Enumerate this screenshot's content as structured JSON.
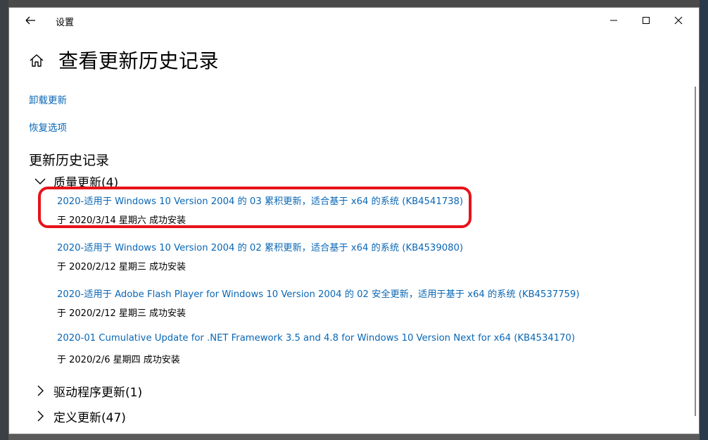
{
  "window": {
    "title": "设置"
  },
  "page": {
    "title": "查看更新历史记录"
  },
  "links": {
    "uninstall": "卸载更新",
    "recovery": "恢复选项"
  },
  "history": {
    "section_title": "更新历史记录",
    "groups": [
      {
        "label": "质量更新(4)",
        "expanded": true,
        "items": [
          {
            "title": "2020-适用于 Windows 10 Version 2004 的 03 累积更新，适合基于 x64 的系统 (KB4541738)",
            "status": "于 2020/3/14 星期六 成功安装",
            "highlighted": true
          },
          {
            "title": "2020-适用于 Windows 10 Version 2004 的 02 累积更新，适合基于 x64 的系统 (KB4539080)",
            "status": "于 2020/2/12 星期三 成功安装",
            "highlighted": false
          },
          {
            "title": "2020-适用于 Adobe Flash Player for Windows 10 Version 2004 的 02 安全更新，适用于基于 x64 的系统 (KB4537759)",
            "status": "于 2020/2/12 星期三 成功安装",
            "highlighted": false
          },
          {
            "title": "2020-01 Cumulative Update for .NET Framework 3.5 and 4.8 for Windows 10 Version Next for x64 (KB4534170)",
            "status": "于 2020/2/6 星期四 成功安装",
            "highlighted": false
          }
        ]
      },
      {
        "label": "驱动程序更新(1)",
        "expanded": false
      },
      {
        "label": "定义更新(47)",
        "expanded": false
      }
    ]
  },
  "colors": {
    "link": "#0a67b5",
    "highlight": "#e5141a",
    "text": "#000000",
    "background": "#ffffff"
  },
  "icons": {
    "back": "back-arrow-icon",
    "home": "home-icon",
    "minimize": "minimize-icon",
    "maximize": "maximize-icon",
    "close": "close-icon",
    "expanded": "chevron-down-icon",
    "collapsed": "chevron-right-icon"
  }
}
